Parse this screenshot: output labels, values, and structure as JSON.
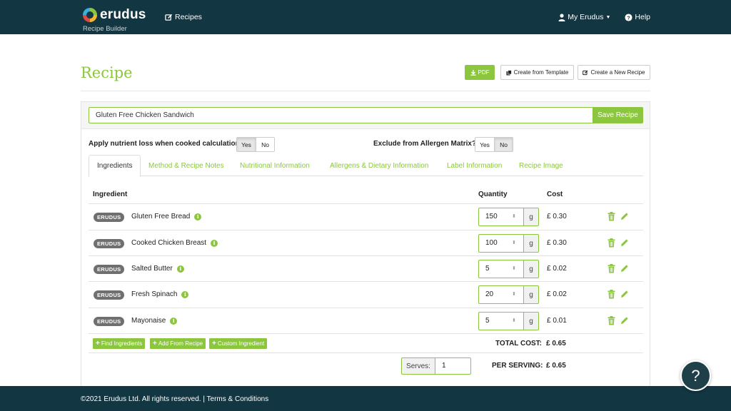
{
  "nav": {
    "brand": "erudus",
    "subtitle": "Recipe Builder",
    "recipes": "Recipes",
    "account": "My Erudus",
    "help": "Help"
  },
  "page": {
    "title": "Recipe",
    "pdf_label": "PDF",
    "template_label": "Create from Template",
    "new_label": "Create a New Recipe"
  },
  "recipe": {
    "name": "Gluten Free Chicken Sandwich",
    "save_label": "Save Recipe"
  },
  "options": {
    "nutrient_label": "Apply nutrient loss when cooked calculations :",
    "allergen_label": "Exclude from Allergen Matrix? :",
    "yes": "Yes",
    "no": "No",
    "nutrient_selected": "Yes",
    "allergen_selected": "No"
  },
  "tabs": [
    {
      "label": "Ingredients"
    },
    {
      "label": "Method & Recipe Notes"
    },
    {
      "label": "Nutritional Information"
    },
    {
      "label": "Allergens & Dietary Information"
    },
    {
      "label": "Label Information"
    },
    {
      "label": "Recipe Image"
    }
  ],
  "table": {
    "headers": {
      "ingredient": "Ingredient",
      "quantity": "Quantity",
      "cost": "Cost"
    },
    "rows": [
      {
        "badge": "ERUDUS",
        "name": "Gluten Free Bread",
        "qty": "150",
        "unit": "g",
        "cost": "£ 0.30"
      },
      {
        "badge": "ERUDUS",
        "name": "Cooked Chicken Breast",
        "qty": "100",
        "unit": "g",
        "cost": "£ 0.30"
      },
      {
        "badge": "ERUDUS",
        "name": "Salted Butter",
        "qty": "5",
        "unit": "g",
        "cost": "£ 0.02"
      },
      {
        "badge": "ERUDUS",
        "name": "Fresh Spinach",
        "qty": "20",
        "unit": "g",
        "cost": "£ 0.02"
      },
      {
        "badge": "ERUDUS",
        "name": "Mayonaise",
        "qty": "5",
        "unit": "g",
        "cost": "£ 0.01"
      }
    ]
  },
  "actions": {
    "find": "Find Ingredients",
    "add_recipe": "Add From Recipe",
    "custom": "Custom Ingredient"
  },
  "totals": {
    "total_label": "TOTAL COST:",
    "total_value": "£ 0.65",
    "serves_label": "Serves:",
    "serves_value": "1",
    "per_serving_label": "PER SERVING:",
    "per_serving_value": "£ 0.65"
  },
  "footer": {
    "text": "©2021 Erudus Ltd. All rights reserved. | Terms & Conditions"
  },
  "help_fab": "?",
  "colors": {
    "brand_green": "#8cc63f",
    "navbar": "#123642"
  }
}
